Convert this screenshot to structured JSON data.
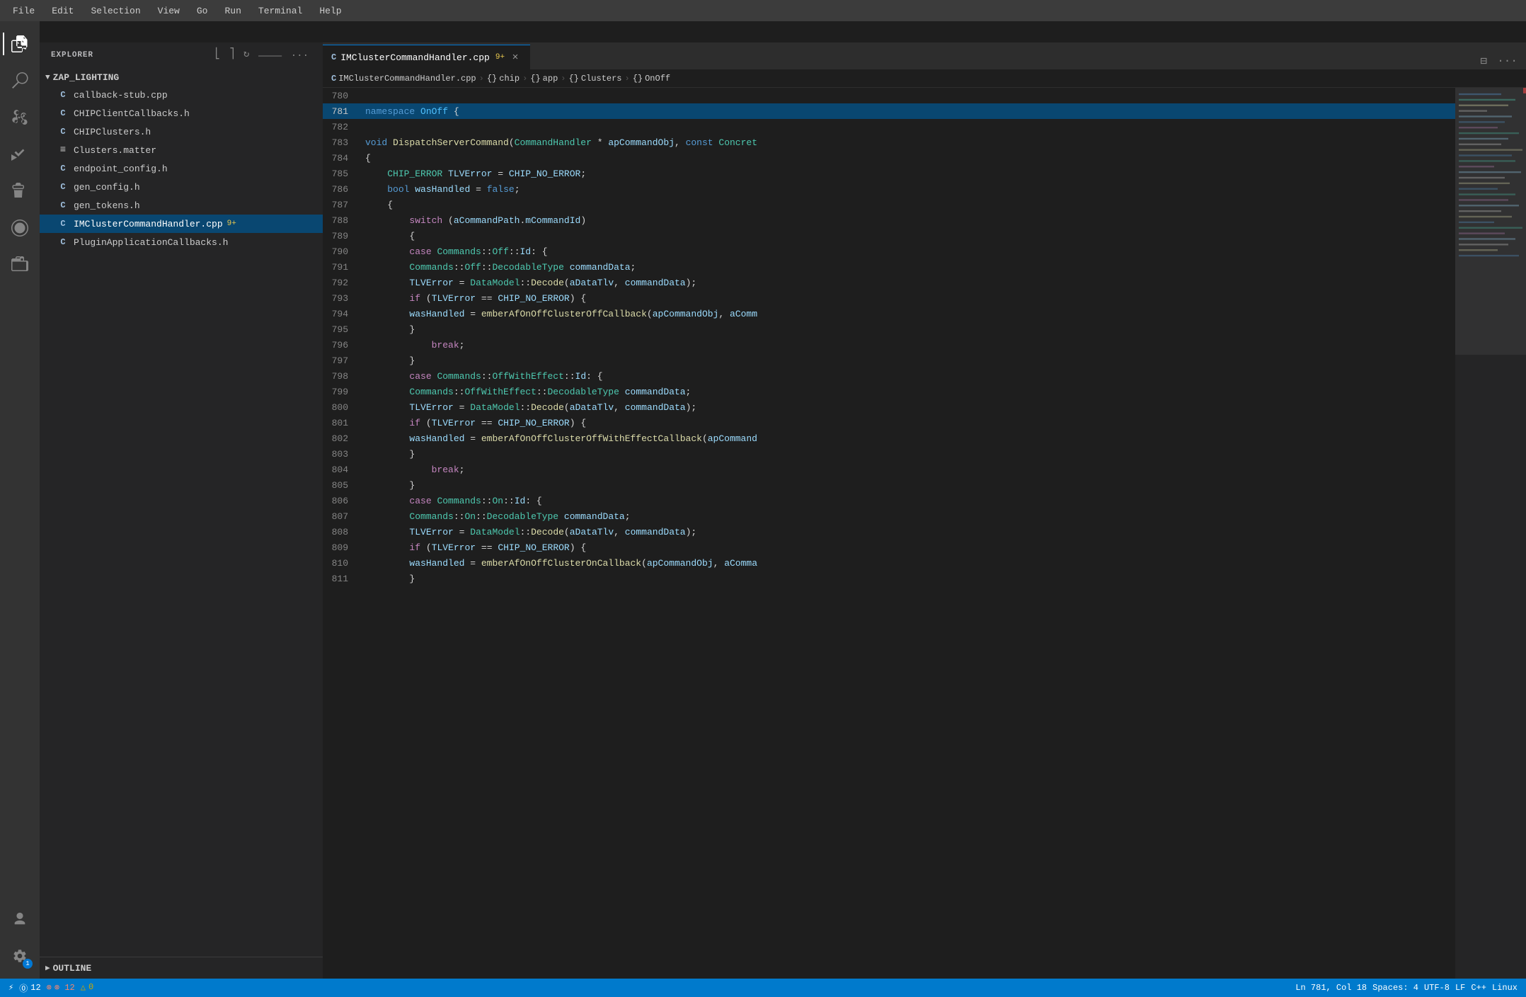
{
  "menubar": {
    "items": [
      "File",
      "Edit",
      "Selection",
      "View",
      "Go",
      "Run",
      "Terminal",
      "Help"
    ]
  },
  "activity": {
    "icons": [
      {
        "name": "explorer-icon",
        "symbol": "⎘",
        "active": true
      },
      {
        "name": "search-icon",
        "symbol": "🔍",
        "active": false
      },
      {
        "name": "source-control-icon",
        "symbol": "⑂",
        "active": false
      },
      {
        "name": "run-debug-icon",
        "symbol": "▷",
        "active": false
      },
      {
        "name": "extensions-icon",
        "symbol": "⊞",
        "active": false
      },
      {
        "name": "remote-explorer-icon",
        "symbol": "⊕",
        "active": false
      },
      {
        "name": "timeline-icon",
        "symbol": "◷",
        "active": false
      }
    ],
    "bottom_icons": [
      {
        "name": "account-icon",
        "symbol": "◯"
      },
      {
        "name": "settings-icon",
        "symbol": "⚙",
        "badge": "1"
      }
    ]
  },
  "sidebar": {
    "title": "EXPLORER",
    "more_btn": "...",
    "folder": {
      "name": "ZAP_LIGHTING",
      "expanded": true
    },
    "files": [
      {
        "name": "callback-stub.cpp",
        "icon": "c",
        "active": false
      },
      {
        "name": "CHIPClientCallbacks.h",
        "icon": "c",
        "active": false
      },
      {
        "name": "CHIPClusters.h",
        "icon": "c",
        "active": false
      },
      {
        "name": "Clusters.matter",
        "icon": "eq",
        "active": false
      },
      {
        "name": "endpoint_config.h",
        "icon": "c",
        "active": false
      },
      {
        "name": "gen_config.h",
        "icon": "c",
        "active": false
      },
      {
        "name": "gen_tokens.h",
        "icon": "c",
        "active": false
      },
      {
        "name": "IMClusterCommandHandler.cpp",
        "icon": "c",
        "active": true,
        "modified": "9+"
      },
      {
        "name": "PluginApplicationCallbacks.h",
        "icon": "c",
        "active": false
      }
    ],
    "outline": {
      "label": "OUTLINE"
    }
  },
  "tabs": [
    {
      "label": "IMClusterCommandHandler.cpp",
      "modified": "9+",
      "active": true,
      "icon": "c"
    }
  ],
  "breadcrumb": {
    "items": [
      {
        "type": "file",
        "label": "IMClusterCommandHandler.cpp"
      },
      {
        "type": "braces",
        "label": "chip"
      },
      {
        "type": "braces",
        "label": "app"
      },
      {
        "type": "braces",
        "label": "Clusters"
      },
      {
        "type": "braces",
        "label": "OnOff"
      }
    ]
  },
  "code": {
    "lines": [
      {
        "num": "780",
        "content": ""
      },
      {
        "num": "781",
        "content": "namespace OnOff {"
      },
      {
        "num": "782",
        "content": ""
      },
      {
        "num": "783",
        "content": "void DispatchServerCommand(CommandHandler * apCommandObj, const Concret"
      },
      {
        "num": "784",
        "content": "{"
      },
      {
        "num": "785",
        "content": "    CHIP_ERROR TLVError = CHIP_NO_ERROR;"
      },
      {
        "num": "786",
        "content": "    bool wasHandled = false;"
      },
      {
        "num": "787",
        "content": "{"
      },
      {
        "num": "788",
        "content": "        switch (aCommandPath.mCommandId)"
      },
      {
        "num": "789",
        "content": "        {"
      },
      {
        "num": "790",
        "content": "        case Commands::Off::Id: {"
      },
      {
        "num": "791",
        "content": "        Commands::Off::DecodableType commandData;"
      },
      {
        "num": "792",
        "content": "        TLVError = DataModel::Decode(aDataTlv, commandData);"
      },
      {
        "num": "793",
        "content": "        if (TLVError == CHIP_NO_ERROR) {"
      },
      {
        "num": "794",
        "content": "        wasHandled = emberAfOnOffClusterOffCallback(apCommandObj, aComm"
      },
      {
        "num": "795",
        "content": "        }"
      },
      {
        "num": "796",
        "content": "            break;"
      },
      {
        "num": "797",
        "content": "        }"
      },
      {
        "num": "798",
        "content": "        case Commands::OffWithEffect::Id: {"
      },
      {
        "num": "799",
        "content": "        Commands::OffWithEffect::DecodableType commandData;"
      },
      {
        "num": "800",
        "content": "        TLVError = DataModel::Decode(aDataTlv, commandData);"
      },
      {
        "num": "801",
        "content": "        if (TLVError == CHIP_NO_ERROR) {"
      },
      {
        "num": "802",
        "content": "        wasHandled = emberAfOnOffClusterOffWithEffectCallback(apCommand"
      },
      {
        "num": "803",
        "content": "        }"
      },
      {
        "num": "804",
        "content": "            break;"
      },
      {
        "num": "805",
        "content": "        }"
      },
      {
        "num": "806",
        "content": "        case Commands::On::Id: {"
      },
      {
        "num": "807",
        "content": "        Commands::On::DecodableType commandData;"
      },
      {
        "num": "808",
        "content": "        TLVError = DataModel::Decode(aDataTlv, commandData);"
      },
      {
        "num": "809",
        "content": "        if (TLVError == CHIP_NO_ERROR) {"
      },
      {
        "num": "810",
        "content": "        wasHandled = emberAfOnOffClusterOnCallback(apCommandObj, aComma"
      },
      {
        "num": "811",
        "content": "        }"
      }
    ]
  },
  "status": {
    "git": "⓪ 12",
    "errors": "⊗ 12",
    "warnings": "△ 0",
    "line_col": "Ln 781, Col 18",
    "spaces": "Spaces: 4",
    "encoding": "UTF-8",
    "eol": "LF",
    "lang": "C++",
    "os": "Linux",
    "remote": ""
  }
}
